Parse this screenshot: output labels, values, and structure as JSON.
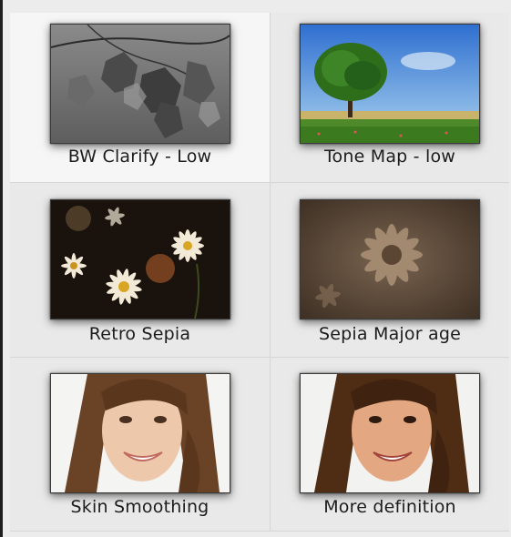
{
  "presets": [
    {
      "label": "BW Clarify - Low",
      "selected": true,
      "image": "bw-leaves-thumbnail"
    },
    {
      "label": "Tone Map - low",
      "selected": false,
      "image": "tree-landscape-thumbnail"
    },
    {
      "label": "Retro Sepia",
      "selected": false,
      "image": "daisies-thumbnail"
    },
    {
      "label": "Sepia Major age",
      "selected": false,
      "image": "sepia-flower-thumbnail"
    },
    {
      "label": "Skin Smoothing",
      "selected": false,
      "image": "smiling-woman-thumbnail"
    },
    {
      "label": "More definition",
      "selected": false,
      "image": "smiling-woman-defined-thumbnail"
    }
  ]
}
